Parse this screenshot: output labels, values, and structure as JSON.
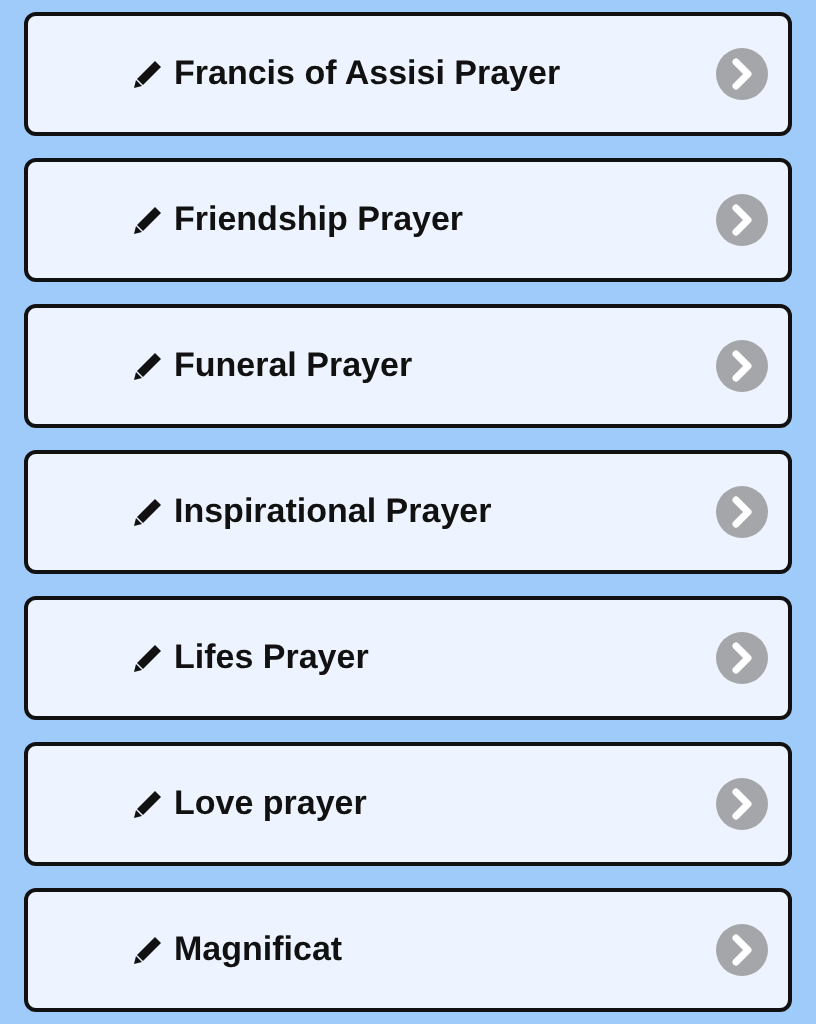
{
  "items": [
    {
      "label": "Francis of Assisi Prayer"
    },
    {
      "label": "Friendship Prayer"
    },
    {
      "label": "Funeral Prayer"
    },
    {
      "label": "Inspirational Prayer"
    },
    {
      "label": "Lifes Prayer"
    },
    {
      "label": "Love prayer"
    },
    {
      "label": "Magnificat"
    }
  ]
}
